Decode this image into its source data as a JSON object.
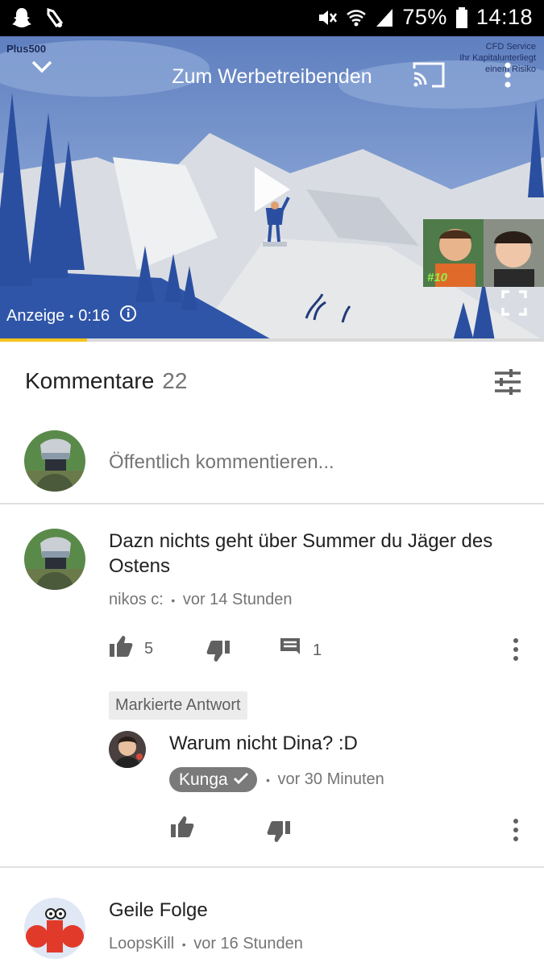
{
  "status_bar": {
    "battery": "75%",
    "time": "14:18",
    "icons": [
      "snapchat-icon",
      "notification-icon",
      "mute-icon",
      "wifi-icon",
      "signal-icon",
      "battery-icon"
    ]
  },
  "video": {
    "title": "Zum Werbetreibenden",
    "brand": "Plus500",
    "disclaimer": [
      "CFD Service",
      "Ihr Kapitalunterliegt",
      "einem Risiko"
    ],
    "ad_label": "Anzeige",
    "ad_time": "0:16",
    "thumbnail_label": "#10",
    "progress": 0.16
  },
  "comments": {
    "heading": "Kommentare",
    "count": "22",
    "input_placeholder": "Öffentlich kommentieren...",
    "items": [
      {
        "text": "Dazn nichts geht über Summer du Jäger des Ostens",
        "author": "nikos c:",
        "time": "vor 14 Stunden",
        "likes": "5",
        "replies": "1"
      },
      {
        "text": "Geile Folge",
        "author": "LoopsKill",
        "time": "vor 16 Stunden"
      }
    ],
    "highlighted_reply": {
      "tag": "Markierte Antwort",
      "text": "Warum nicht Dina? :D",
      "author": "Kunga",
      "time": "vor 30 Minuten"
    },
    "separator": "•"
  },
  "colors": {
    "accent_progress": "#f7c21a",
    "text_primary": "#212121",
    "text_secondary": "#757575"
  }
}
